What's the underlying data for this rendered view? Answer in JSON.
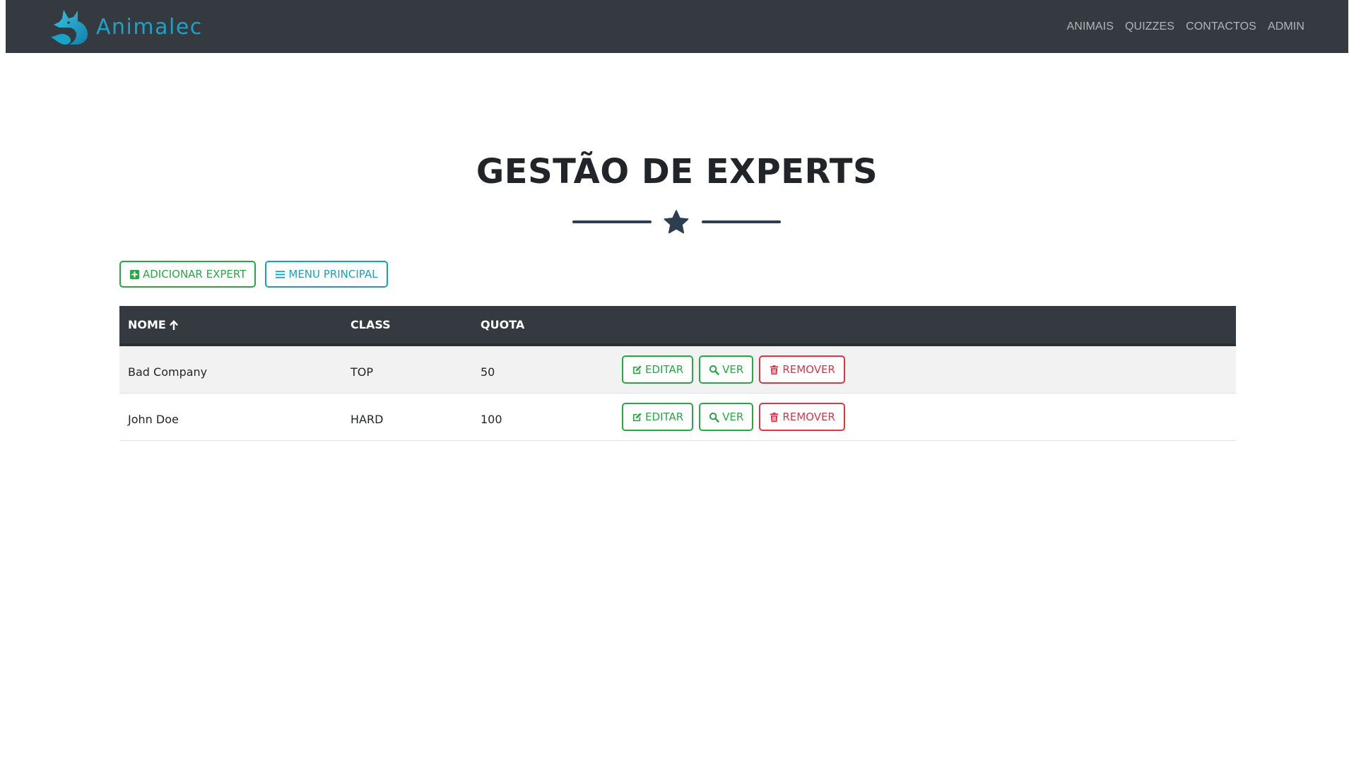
{
  "brand": {
    "name": "Animalec",
    "logo_icon": "fox-logo-icon",
    "color": "#1aa3c9"
  },
  "nav": {
    "links": [
      {
        "label": "ANIMAIS"
      },
      {
        "label": "QUIZZES"
      },
      {
        "label": "CONTACTOS"
      },
      {
        "label": "ADMIN"
      }
    ]
  },
  "page": {
    "title": "GESTÃO DE EXPERTS",
    "divider_icon": "star-icon"
  },
  "toolbar": {
    "add_label": "ADICIONAR EXPERT",
    "add_icon": "plus-square-icon",
    "menu_label": "MENU PRINCIPAL",
    "menu_icon": "bars-icon"
  },
  "table": {
    "headers": {
      "name": "NOME",
      "name_sort_icon": "arrow-up-icon",
      "class": "CLASS",
      "quota": "QUOTA"
    },
    "rows": [
      {
        "name": "Bad Company",
        "class": "TOP",
        "quota": "50"
      },
      {
        "name": "John Doe",
        "class": "HARD",
        "quota": "100"
      }
    ],
    "row_actions": {
      "edit_label": "EDITAR",
      "edit_icon": "edit-icon",
      "view_label": "VER",
      "view_icon": "search-icon",
      "remove_label": "REMOVER",
      "remove_icon": "trash-icon"
    }
  },
  "colors": {
    "navbar_bg": "#343a40",
    "success": "#28a745",
    "info": "#17a2b8",
    "danger": "#dc3545",
    "divider": "#2c3e50"
  }
}
